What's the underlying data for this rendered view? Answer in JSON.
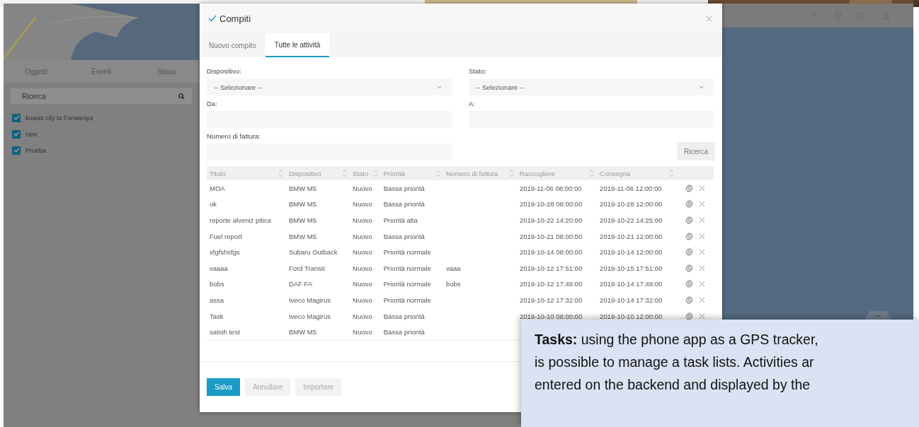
{
  "sidebar": {
    "tabs": [
      {
        "label": "Oggetti",
        "selected": false
      },
      {
        "label": "Eventi",
        "selected": false
      },
      {
        "label": "Storia",
        "selected": false
      }
    ],
    "search": {
      "placeholder": "Ricerca"
    },
    "items": [
      {
        "label": "kuwait city to Farwaniya",
        "checked": true
      },
      {
        "label": "new",
        "checked": true
      },
      {
        "label": "Prueba",
        "checked": true
      }
    ]
  },
  "dialog": {
    "title": "Compiti",
    "tabs": [
      {
        "label": "Nuovo compito",
        "selected": false
      },
      {
        "label": "Tutte le attività",
        "selected": true
      }
    ],
    "filters": [
      {
        "kind": "select",
        "label": "Dispositivo:",
        "value": "-- Selezionare --"
      },
      {
        "kind": "select",
        "label": "Stato:",
        "value": "-- Selezionare --"
      },
      {
        "kind": "input",
        "label": "Da:"
      },
      {
        "kind": "input",
        "label": "A:"
      },
      {
        "kind": "input",
        "label": "Numero di fattura:"
      }
    ],
    "search_button": "Ricerca",
    "table": {
      "columns": [
        "Titolo",
        "Dispositivo",
        "Stato",
        "Priorità",
        "Numero di fattura",
        "Raccogliere",
        "Consegna"
      ],
      "rows": [
        [
          "MOA",
          "BMW M5",
          "Nuovo",
          "Bassa priorità",
          "",
          "2019-11-06 08:00:00",
          "2019-11-06 12:00:00"
        ],
        [
          "ok",
          "BMW M5",
          "Nuovo",
          "Bassa priorità",
          "",
          "2019-10-28 08:00:00",
          "2019-10-28 12:00:00"
        ],
        [
          "reporte alveniz pitica",
          "BMW M5",
          "Nuovo",
          "Priorità alta",
          "",
          "2019-10-22 14:20:00",
          "2019-10-22 14:25:00"
        ],
        [
          "Fuel report",
          "BMW M5",
          "Nuovo",
          "Bassa priorità",
          "",
          "2019-10-21 08:00:00",
          "2019-10-21 12:00:00"
        ],
        [
          "xfgfshsfgs",
          "Subaru Outback",
          "Nuovo",
          "Priorità normale",
          "",
          "2019-10-14 08:00:00",
          "2019-10-14 12:00:00"
        ],
        [
          "vaaaa",
          "Ford Transit",
          "Nuovo",
          "Priorità normale",
          "vaaa",
          "2019-10-12 17:51:00",
          "2019-10-15 17:51:00"
        ],
        [
          "bobs",
          "DAF FA",
          "Nuovo",
          "Priorità normale",
          "bobs",
          "2019-10-12 17:49:00",
          "2019-10-14 17:49:00"
        ],
        [
          "assa",
          "Iveco Magirus",
          "Nuovo",
          "Priorità normale",
          "",
          "2019-10-12 17:32:00",
          "2019-10-14 17:32:00"
        ],
        [
          "Task",
          "Iveco Magirus",
          "Nuovo",
          "Bassa priorità",
          "",
          "2019-10-10 08:00:00",
          "2019-10-10 12:00:00"
        ],
        [
          "satish test",
          "BMW M5",
          "Nuovo",
          "Bassa priorità",
          "",
          "",
          ""
        ]
      ]
    },
    "buttons": [
      {
        "label": "Salva",
        "kind": "primary"
      },
      {
        "label": "Annullare",
        "kind": "secondary"
      },
      {
        "label": "Importare",
        "kind": "secondary"
      }
    ]
  },
  "callout": {
    "lines": [
      "**Tasks:** using the phone app as a GPS tracker,",
      "is possible to manage a task lists. Activities ar",
      "entered on the backend and displayed by the"
    ]
  }
}
